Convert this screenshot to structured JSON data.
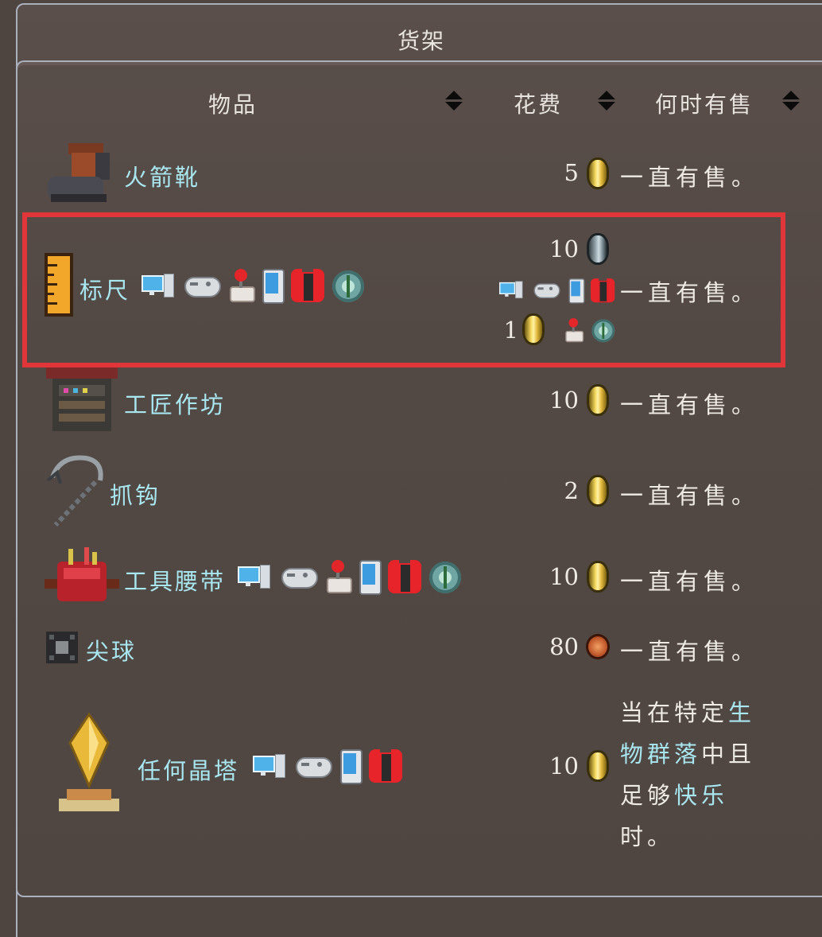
{
  "shelf": {
    "title": "货架"
  },
  "columns": {
    "item": "物品",
    "cost": "花费",
    "availability": "何时有售"
  },
  "rows": [
    {
      "name": "火箭靴",
      "cost": "5",
      "coin": "gold-coin",
      "availability": "一直有售。"
    },
    {
      "name": "标尺",
      "cost_alt": "10",
      "coin_alt": "platinum-coin",
      "cost": "1",
      "coin": "gold-coin",
      "availability": "一直有售。"
    },
    {
      "name": "工匠作坊",
      "cost": "10",
      "coin": "gold-coin",
      "availability": "一直有售。"
    },
    {
      "name": "抓钩",
      "cost": "2",
      "coin": "gold-coin",
      "availability": "一直有售。"
    },
    {
      "name": "工具腰带",
      "cost": "10",
      "coin": "gold-coin",
      "availability": "一直有售。"
    },
    {
      "name": "尖球",
      "cost": "80",
      "coin": "copper-coin",
      "availability": "一直有售。"
    },
    {
      "name": "任何晶塔",
      "cost": "10",
      "coin": "gold-coin",
      "availability_parts": [
        "当在特定",
        "生",
        "物群落",
        "中且",
        "足够",
        "快乐",
        "时。"
      ]
    }
  ],
  "colors": {
    "link": "#a8e6f0",
    "highlight": "#e0363a",
    "text": "#eeeae4"
  },
  "platform_icons": [
    "pc-icon",
    "gamepad-icon",
    "joystick-icon",
    "mobile-icon",
    "switch-icon",
    "tmodloader-icon"
  ]
}
